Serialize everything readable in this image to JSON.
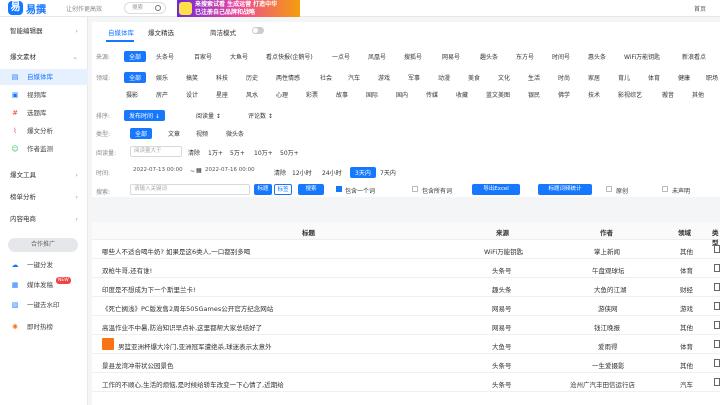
{
  "header": {
    "logo_glyph": "易",
    "app_name": "易撰",
    "slogan": "让创作更高效",
    "search_placeholder": "搜索",
    "banner_line1": "来搜索试看 生成运营 打造中华",
    "banner_line2": "已注册自己品牌和战略",
    "home_link": "首页"
  },
  "sidebar": {
    "groups": [
      {
        "label": "智能编辑器"
      },
      {
        "label": "爆文素材"
      },
      {
        "label": "爆文工具"
      },
      {
        "label": "榜单分析"
      },
      {
        "label": "内容电商"
      }
    ],
    "items": [
      {
        "label": "自媒体库",
        "icon": "library-icon"
      },
      {
        "label": "视频库",
        "icon": "video-icon"
      },
      {
        "label": "选题库",
        "icon": "topic-icon"
      },
      {
        "label": "爆文分析",
        "icon": "chart-icon"
      },
      {
        "label": "作者监测",
        "icon": "user-watch-icon"
      }
    ],
    "promo_label": "合作推广",
    "promo_items": [
      {
        "label": "一键分发",
        "icon": "send-icon"
      },
      {
        "label": "媒体发稿",
        "icon": "media-icon",
        "badge": "NEW"
      },
      {
        "label": "一键去水印",
        "icon": "watermark-icon"
      },
      {
        "label": "即时热榜",
        "icon": "fire-icon"
      }
    ]
  },
  "tabs": [
    {
      "label": "自媒体库",
      "active": true
    },
    {
      "label": "爆文精选",
      "active": false
    }
  ],
  "simple_mode_label": "简洁模式",
  "filters": {
    "source_label": "来源:",
    "sources": [
      "全部",
      "头条号",
      "百家号",
      "大鱼号",
      "看点快报(企鹅号)",
      "一点号",
      "凤凰号",
      "搜狐号",
      "网易号",
      "趣头条",
      "东方号",
      "时间号",
      "惠头条",
      "WiFi万能钥匙",
      "新浪看点"
    ],
    "field_label": "领域:",
    "fields_row1": [
      "全部",
      "娱乐",
      "搞笑",
      "科技",
      "历史",
      "两性情感",
      "社会",
      "汽车",
      "游戏",
      "军事",
      "动漫",
      "美食",
      "文化",
      "生活",
      "时尚",
      "家居",
      "育儿",
      "体育",
      "健康",
      "职场"
    ],
    "fields_row2": [
      "摄影",
      "房产",
      "设计",
      "星座",
      "风水",
      "心理",
      "彩票",
      "故事",
      "国际",
      "国内",
      "传媒",
      "收藏",
      "蓝文美图",
      "银民",
      "佛学",
      "技术",
      "影视综艺",
      "搬音",
      "其他"
    ],
    "sort_label": "排序:",
    "sorts": [
      "发布时间",
      "阅读量",
      "评论数"
    ],
    "type_label": "类型:",
    "types": [
      "全部",
      "文章",
      "视频",
      "微头条"
    ],
    "read_label": "阅读量:",
    "read_placeholder": "阅读量大于",
    "read_clear": "清除",
    "read_presets": [
      "1万+",
      "5万+",
      "10万+",
      "50万+"
    ],
    "time_label": "时间:",
    "date_from": "2022-07-13 00:00",
    "date_to": "2022-07-16 00:00",
    "time_clear": "清除",
    "time_presets": [
      "12小时",
      "24小时",
      "3天内",
      "7天内"
    ],
    "search_label": "搜索:",
    "search_placeholder": "请输入关键词",
    "btn_title": "标题",
    "btn_tag": "标签",
    "btn_search": "搜索",
    "include_word": "包含一个词",
    "include_all": "包含所有词",
    "export_btn": "导出Excel",
    "stats_btn": "标题词频统计",
    "original_label": "原创",
    "unread_label": "未声明"
  },
  "table": {
    "columns": [
      "标题",
      "来源",
      "作者",
      "领域",
      "类型"
    ],
    "rows": [
      {
        "title": "哪些人不适合喝牛奶? 如果是这6类人,一口都别多喝",
        "source": "WiFi万能钥匙",
        "author": "掌上新闻",
        "field": "其他"
      },
      {
        "title": "双枪牛哥,还有谁!",
        "source": "头条号",
        "author": "午盘观球坛",
        "field": "体育"
      },
      {
        "title": "印度是不想成为下一个斯里兰卡!",
        "source": "趣头条",
        "author": "大鱼的江湖",
        "field": "财经"
      },
      {
        "title": "《死亡搁浅》PC版发售2周年505Games公开官方纪念网站",
        "source": "网易号",
        "author": "游侠网",
        "field": "游戏"
      },
      {
        "title": "高温作业不中暑,防治知识早点补,这里都帮大家总结好了",
        "source": "网易号",
        "author": "钱江晚报",
        "field": "其他"
      },
      {
        "title": "男篮亚洲杯爆大冷门,亚洲冠军遭绝杀,球迷表示太意外",
        "source": "大鱼号",
        "author": "爱雨得",
        "field": "体育",
        "thumb": true
      },
      {
        "title": "景县龙湾冲带状公园景色",
        "source": "头条号",
        "author": "一生爱摄影",
        "field": "其他"
      },
      {
        "title": "工作的不顺心,生活的烦恼,是时候给轿车改变一下心情了,近期给",
        "source": "头条号",
        "author": "沧州广汽丰田信运行店",
        "field": "汽车"
      }
    ]
  },
  "colors": {
    "accent": "#1677ff"
  }
}
